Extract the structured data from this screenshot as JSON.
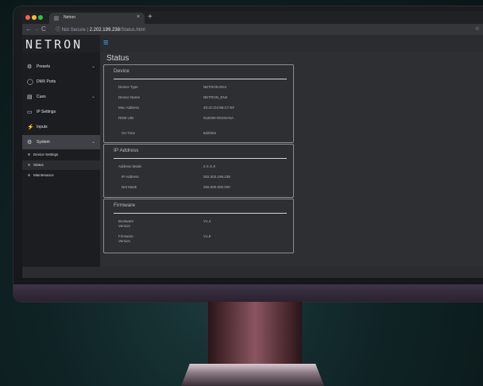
{
  "browser": {
    "tab_title": "Netron",
    "security_label": "Not Secure",
    "url_host": "2.202.199.238",
    "url_path": "/Status.html"
  },
  "app": {
    "logo": "NETRON"
  },
  "sidebar": {
    "items": [
      {
        "label": "Presets",
        "icon": "gear-icon",
        "chevron": true
      },
      {
        "label": "DMX Ports",
        "icon": "ring-icon",
        "chevron": false
      },
      {
        "label": "Cues",
        "icon": "film-icon",
        "chevron": true
      },
      {
        "label": "IP Settings",
        "icon": "monitor-icon",
        "chevron": false
      },
      {
        "label": "Inputs",
        "icon": "plug-icon",
        "chevron": false
      },
      {
        "label": "System",
        "icon": "gear-icon",
        "chevron": true
      }
    ],
    "subitems": [
      {
        "label": "Device Settings"
      },
      {
        "label": "Status"
      },
      {
        "label": "Maintenance"
      }
    ]
  },
  "main": {
    "title": "Status",
    "cards": {
      "device": {
        "title": "Device",
        "rows": [
          {
            "label": "Device Type",
            "value": "NETRON EN4"
          },
          {
            "label": "Device Name",
            "value": "NETRON_EN4"
          },
          {
            "label": "Mac Address",
            "value": "40:4C:D4:86:C7:EF"
          },
          {
            "label": "RDM UID",
            "value": "0x2D90-00103A5A"
          },
          {
            "label": "On Time",
            "value": "6d2h5m"
          }
        ]
      },
      "ip": {
        "title": "IP Address",
        "rows": [
          {
            "label": "Address Mode",
            "value": "2.X.X.X"
          },
          {
            "label": "IP Address",
            "value": "002.202.199.238"
          },
          {
            "label": "Net Mask",
            "value": "255.000.000.000"
          }
        ]
      },
      "firmware": {
        "title": "Firmware",
        "rows": [
          {
            "label": "Bootware Version",
            "value": "V1.4"
          },
          {
            "label": "Firmware Version",
            "value": "V1.8"
          }
        ]
      }
    }
  }
}
